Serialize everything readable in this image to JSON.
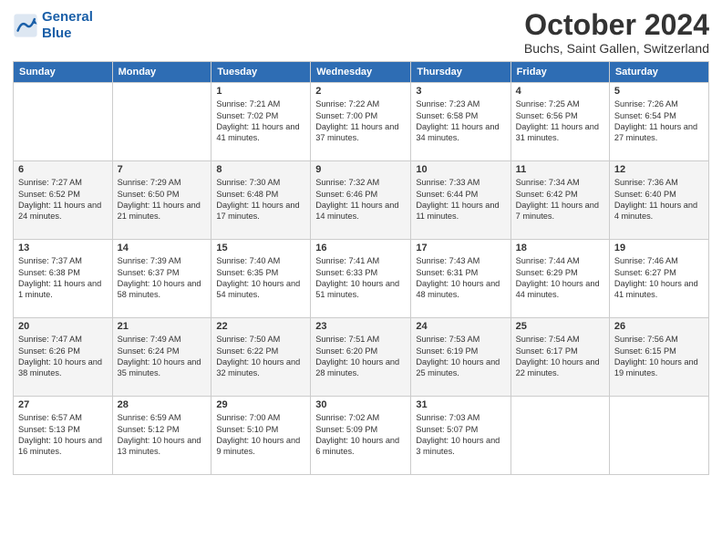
{
  "header": {
    "logo_line1": "General",
    "logo_line2": "Blue",
    "month": "October 2024",
    "location": "Buchs, Saint Gallen, Switzerland"
  },
  "weekdays": [
    "Sunday",
    "Monday",
    "Tuesday",
    "Wednesday",
    "Thursday",
    "Friday",
    "Saturday"
  ],
  "weeks": [
    [
      {
        "day": "",
        "info": ""
      },
      {
        "day": "",
        "info": ""
      },
      {
        "day": "1",
        "info": "Sunrise: 7:21 AM\nSunset: 7:02 PM\nDaylight: 11 hours and 41 minutes."
      },
      {
        "day": "2",
        "info": "Sunrise: 7:22 AM\nSunset: 7:00 PM\nDaylight: 11 hours and 37 minutes."
      },
      {
        "day": "3",
        "info": "Sunrise: 7:23 AM\nSunset: 6:58 PM\nDaylight: 11 hours and 34 minutes."
      },
      {
        "day": "4",
        "info": "Sunrise: 7:25 AM\nSunset: 6:56 PM\nDaylight: 11 hours and 31 minutes."
      },
      {
        "day": "5",
        "info": "Sunrise: 7:26 AM\nSunset: 6:54 PM\nDaylight: 11 hours and 27 minutes."
      }
    ],
    [
      {
        "day": "6",
        "info": "Sunrise: 7:27 AM\nSunset: 6:52 PM\nDaylight: 11 hours and 24 minutes."
      },
      {
        "day": "7",
        "info": "Sunrise: 7:29 AM\nSunset: 6:50 PM\nDaylight: 11 hours and 21 minutes."
      },
      {
        "day": "8",
        "info": "Sunrise: 7:30 AM\nSunset: 6:48 PM\nDaylight: 11 hours and 17 minutes."
      },
      {
        "day": "9",
        "info": "Sunrise: 7:32 AM\nSunset: 6:46 PM\nDaylight: 11 hours and 14 minutes."
      },
      {
        "day": "10",
        "info": "Sunrise: 7:33 AM\nSunset: 6:44 PM\nDaylight: 11 hours and 11 minutes."
      },
      {
        "day": "11",
        "info": "Sunrise: 7:34 AM\nSunset: 6:42 PM\nDaylight: 11 hours and 7 minutes."
      },
      {
        "day": "12",
        "info": "Sunrise: 7:36 AM\nSunset: 6:40 PM\nDaylight: 11 hours and 4 minutes."
      }
    ],
    [
      {
        "day": "13",
        "info": "Sunrise: 7:37 AM\nSunset: 6:38 PM\nDaylight: 11 hours and 1 minute."
      },
      {
        "day": "14",
        "info": "Sunrise: 7:39 AM\nSunset: 6:37 PM\nDaylight: 10 hours and 58 minutes."
      },
      {
        "day": "15",
        "info": "Sunrise: 7:40 AM\nSunset: 6:35 PM\nDaylight: 10 hours and 54 minutes."
      },
      {
        "day": "16",
        "info": "Sunrise: 7:41 AM\nSunset: 6:33 PM\nDaylight: 10 hours and 51 minutes."
      },
      {
        "day": "17",
        "info": "Sunrise: 7:43 AM\nSunset: 6:31 PM\nDaylight: 10 hours and 48 minutes."
      },
      {
        "day": "18",
        "info": "Sunrise: 7:44 AM\nSunset: 6:29 PM\nDaylight: 10 hours and 44 minutes."
      },
      {
        "day": "19",
        "info": "Sunrise: 7:46 AM\nSunset: 6:27 PM\nDaylight: 10 hours and 41 minutes."
      }
    ],
    [
      {
        "day": "20",
        "info": "Sunrise: 7:47 AM\nSunset: 6:26 PM\nDaylight: 10 hours and 38 minutes."
      },
      {
        "day": "21",
        "info": "Sunrise: 7:49 AM\nSunset: 6:24 PM\nDaylight: 10 hours and 35 minutes."
      },
      {
        "day": "22",
        "info": "Sunrise: 7:50 AM\nSunset: 6:22 PM\nDaylight: 10 hours and 32 minutes."
      },
      {
        "day": "23",
        "info": "Sunrise: 7:51 AM\nSunset: 6:20 PM\nDaylight: 10 hours and 28 minutes."
      },
      {
        "day": "24",
        "info": "Sunrise: 7:53 AM\nSunset: 6:19 PM\nDaylight: 10 hours and 25 minutes."
      },
      {
        "day": "25",
        "info": "Sunrise: 7:54 AM\nSunset: 6:17 PM\nDaylight: 10 hours and 22 minutes."
      },
      {
        "day": "26",
        "info": "Sunrise: 7:56 AM\nSunset: 6:15 PM\nDaylight: 10 hours and 19 minutes."
      }
    ],
    [
      {
        "day": "27",
        "info": "Sunrise: 6:57 AM\nSunset: 5:13 PM\nDaylight: 10 hours and 16 minutes."
      },
      {
        "day": "28",
        "info": "Sunrise: 6:59 AM\nSunset: 5:12 PM\nDaylight: 10 hours and 13 minutes."
      },
      {
        "day": "29",
        "info": "Sunrise: 7:00 AM\nSunset: 5:10 PM\nDaylight: 10 hours and 9 minutes."
      },
      {
        "day": "30",
        "info": "Sunrise: 7:02 AM\nSunset: 5:09 PM\nDaylight: 10 hours and 6 minutes."
      },
      {
        "day": "31",
        "info": "Sunrise: 7:03 AM\nSunset: 5:07 PM\nDaylight: 10 hours and 3 minutes."
      },
      {
        "day": "",
        "info": ""
      },
      {
        "day": "",
        "info": ""
      }
    ]
  ]
}
